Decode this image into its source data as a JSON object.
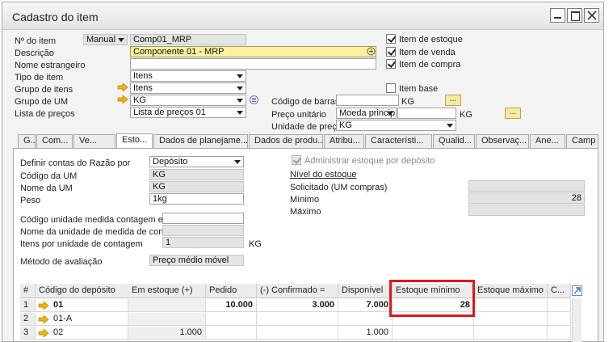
{
  "window": {
    "title": "Cadastro do item"
  },
  "header": {
    "item_no_label": "Nº do item",
    "item_no_mode": "Manual",
    "item_no_value": "Comp01_MRP",
    "description_label": "Descrição",
    "description_value": "Componente 01 - MRP",
    "foreign_name_label": "Nome estrangeiro",
    "foreign_name_value": "",
    "item_type_label": "Tipo de item",
    "item_type_value": "Itens",
    "item_group_label": "Grupo de itens",
    "item_group_value": "Itens",
    "uom_group_label": "Grupo de UM",
    "uom_group_value": "KG",
    "price_list_label": "Lista de preços",
    "price_list_value": "Lista de preços 01",
    "barcode_label": "Código de barras",
    "barcode_value": "",
    "barcode_uom": "KG",
    "unit_price_label": "Preço unitário",
    "unit_price_currency": "Moeda princip",
    "unit_price_value": "",
    "unit_price_uom": "KG",
    "price_unit_label": "Unidade de preço",
    "price_unit_value": "KG",
    "checkboxes": [
      {
        "label": "Item de estoque",
        "checked": true
      },
      {
        "label": "Item de venda",
        "checked": true
      },
      {
        "label": "Item de compra",
        "checked": true
      },
      {
        "label": "Item base",
        "checked": false
      }
    ],
    "browse_label": "..."
  },
  "tabs": [
    {
      "label": "G..."
    },
    {
      "label": "Com..."
    },
    {
      "label": "Ve..."
    },
    {
      "label": "Esto..."
    },
    {
      "label": "Dados de planejame..."
    },
    {
      "label": "Dados de produ..."
    },
    {
      "label": "Atribu..."
    },
    {
      "label": "Característi..."
    },
    {
      "label": "Qualid..."
    },
    {
      "label": "Observaç..."
    },
    {
      "label": "Ane..."
    },
    {
      "label": "Camp"
    }
  ],
  "inventory": {
    "gl_accounts_label": "Definir contas do Razão por",
    "gl_accounts_value": "Depósito",
    "uom_code_label": "Código da UM",
    "uom_code_value": "KG",
    "uom_name_label": "Nome da UM",
    "uom_name_value": "KG",
    "weight_label": "Peso",
    "weight_value": "1kg",
    "count_uom_code_label": "Código unidade medida contagem esto",
    "count_uom_code_value": "",
    "count_uom_name_label": "Nome da unidade de medida de contag",
    "count_uom_name_value": "",
    "items_per_count_label": "Itens por unidade de contagem",
    "items_per_count_value": "1",
    "items_per_count_uom": "KG",
    "valuation_label": "Método de avaliação",
    "valuation_value": "Preço médio móvel",
    "manage_by_wh_label": "Administrar estoque por depósito",
    "stock_level_title": "Nível do estoque",
    "required_label": "Solicitado (UM compras)",
    "required_value": "",
    "min_label": "Mínimo",
    "min_value": "28",
    "max_label": "Máximo",
    "max_value": ""
  },
  "warehouse_table": {
    "columns": [
      "#",
      "Código do depósito",
      "Em estoque (+)",
      "Pedido",
      "(-) Confirmado =",
      "Disponível",
      "Estoque mínimo",
      "Estoque máximo",
      "C..."
    ],
    "rows": [
      {
        "n": "1",
        "code": "01",
        "in_stock": "",
        "ordered": "10.000",
        "committed": "3.000",
        "available": "7.000",
        "min": "28",
        "max": "",
        "c": ""
      },
      {
        "n": "2",
        "code": "01-A",
        "in_stock": "",
        "ordered": "",
        "committed": "",
        "available": "",
        "min": "",
        "max": "",
        "c": ""
      },
      {
        "n": "3",
        "code": "02",
        "in_stock": "1.000",
        "ordered": "",
        "committed": "",
        "available": "1.000",
        "min": "",
        "max": "",
        "c": ""
      }
    ]
  },
  "colors": {
    "highlight": "#e0161b",
    "description_bg": "#fbf1a0",
    "link_arrow": "#f0b400"
  }
}
